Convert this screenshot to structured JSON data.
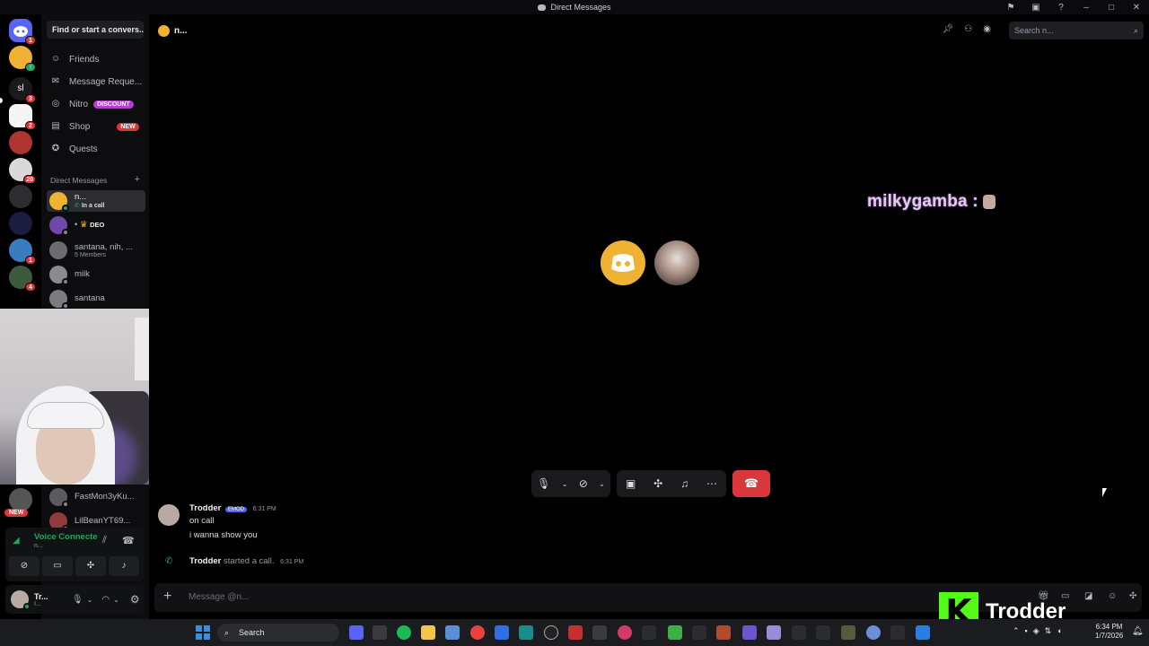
{
  "window": {
    "title": "Direct Messages"
  },
  "sidebar": {
    "find_placeholder": "Find or start a convers...",
    "nav": [
      {
        "label": "Friends",
        "icon": "friends-icon"
      },
      {
        "label": "Message Reque...",
        "icon": "envelope-icon"
      },
      {
        "label": "Nitro",
        "icon": "nitro-icon",
        "tag": "DISCOUNT"
      },
      {
        "label": "Shop",
        "icon": "shop-icon",
        "tag": "NEW"
      },
      {
        "label": "Quests",
        "icon": "quests-icon"
      }
    ],
    "dm_header": "Direct Messages",
    "dm_add": "+",
    "dms": [
      {
        "name": "n...",
        "sub": "In a call"
      },
      {
        "name": "DEO",
        "sub": ""
      },
      {
        "name": "santana, nih, ...",
        "sub": "5 Members"
      },
      {
        "name": "milk",
        "sub": ""
      },
      {
        "name": "santana",
        "sub": ""
      },
      {
        "name": "FastMon3yKu...",
        "sub": ""
      },
      {
        "name": "LilBeanYT69...",
        "sub": ""
      }
    ],
    "server_badges": [
      "1",
      "1",
      "3",
      "2",
      "20",
      "1",
      "4"
    ],
    "new_pill": "NEW",
    "voice": {
      "status": "Voice Connecte",
      "sub": "n..."
    },
    "user": {
      "name": "Tr...",
      "sub": "I..."
    }
  },
  "header": {
    "title": "n...",
    "search_placeholder": "Search n..."
  },
  "call": {
    "overlay_name": "milkygamba :"
  },
  "messages": [
    {
      "author": "Trodder",
      "badge": "EMOD",
      "time": "6:31 PM",
      "lines": [
        "on call",
        "i wanna show you"
      ]
    }
  ],
  "system_message": {
    "author": "Trodder",
    "text": "started a call.",
    "time": "6:31 PM"
  },
  "composer": {
    "placeholder": "Message @n..."
  },
  "brand": {
    "k": "K",
    "name": "Trodder"
  },
  "taskbar": {
    "search": "Search",
    "time": "6:34 PM",
    "date": "1/7/2026"
  },
  "colors": {
    "accent": "#5865f2",
    "green": "#23a55a",
    "red": "#da373c",
    "kick": "#53fc18"
  }
}
